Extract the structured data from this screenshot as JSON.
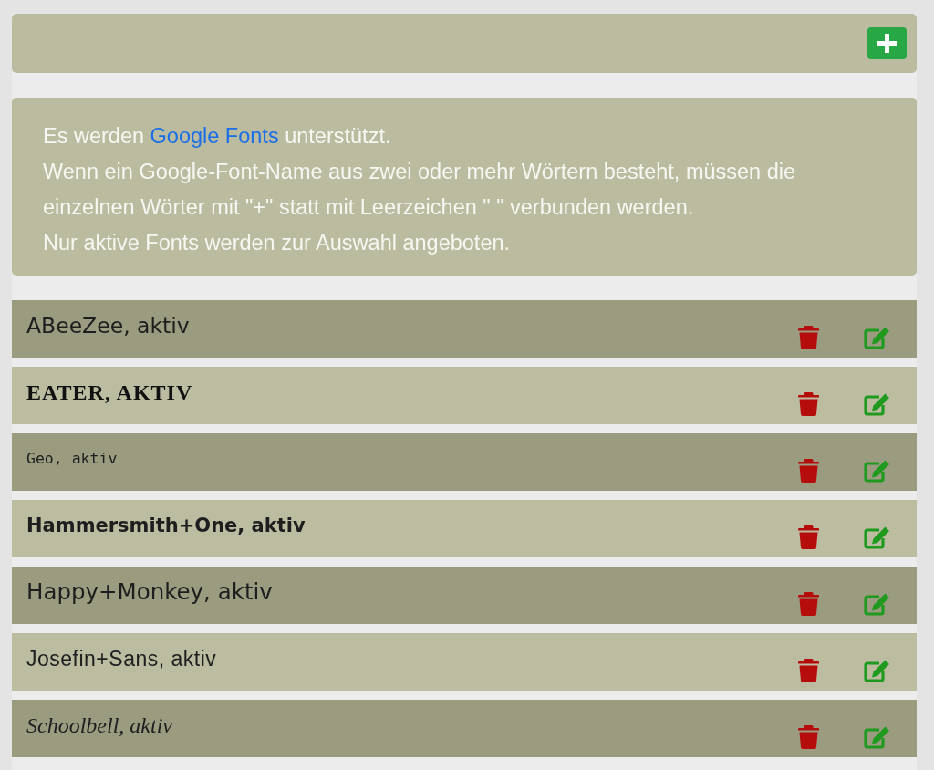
{
  "toolbar": {
    "buttons": [
      {
        "kind": "add"
      }
    ]
  },
  "info": {
    "lines": [
      {
        "kind": "linked",
        "before": "Es werden ",
        "link": "Google Fonts",
        "after": " unterstützt."
      },
      {
        "kind": "plain",
        "text": "Wenn ein Google-Font-Name aus zwei oder mehr Wörtern besteht, müssen die einzelnen Wörter mit \"+\" statt mit Leerzeichen \" \" verbunden werden."
      },
      {
        "kind": "plain",
        "text": "Nur aktive Fonts werden zur Auswahl angeboten."
      }
    ]
  },
  "fonts": [
    {
      "label": "ABeeZee, aktiv",
      "actions": [
        {
          "kind": "delete"
        },
        {
          "kind": "edit"
        }
      ]
    },
    {
      "label": "EATER, AKTIV",
      "actions": [
        {
          "kind": "delete"
        },
        {
          "kind": "edit"
        }
      ]
    },
    {
      "label": "Geo, aktiv",
      "actions": [
        {
          "kind": "delete"
        },
        {
          "kind": "edit"
        }
      ]
    },
    {
      "label": "Hammersmith+One, aktiv",
      "actions": [
        {
          "kind": "delete"
        },
        {
          "kind": "edit"
        }
      ]
    },
    {
      "label": "Happy+Monkey, aktiv",
      "actions": [
        {
          "kind": "delete"
        },
        {
          "kind": "edit"
        }
      ]
    },
    {
      "label": "Josefin+Sans, aktiv",
      "actions": [
        {
          "kind": "delete"
        },
        {
          "kind": "edit"
        }
      ]
    },
    {
      "label": "Schoolbell, aktiv",
      "actions": [
        {
          "kind": "delete"
        },
        {
          "kind": "edit"
        }
      ]
    }
  ]
}
